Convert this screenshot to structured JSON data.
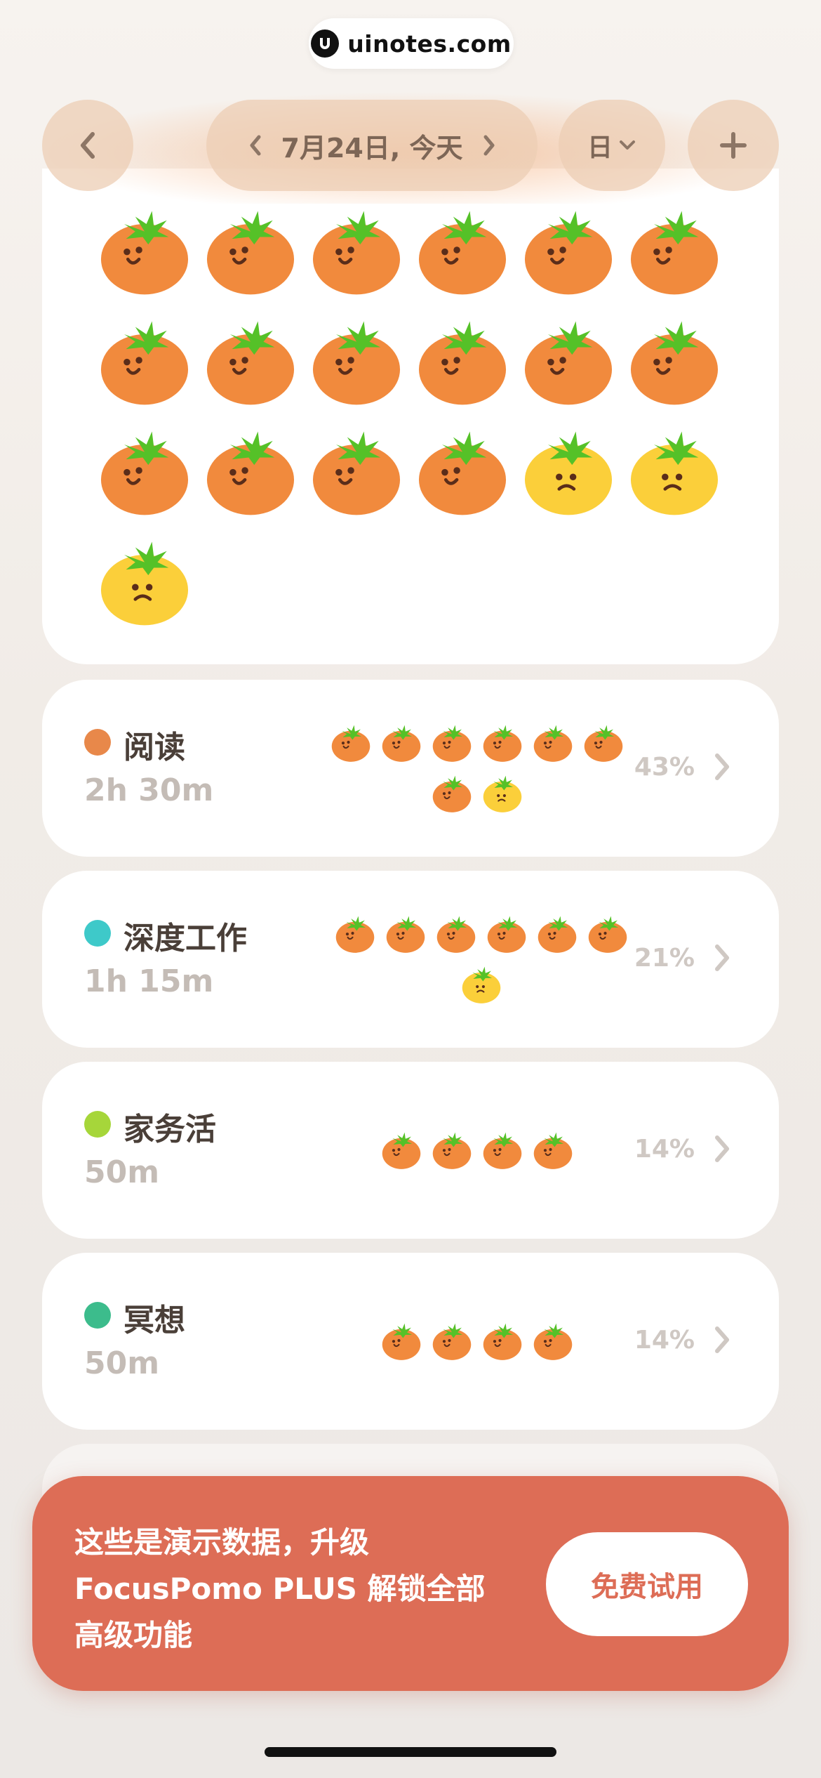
{
  "watermark": {
    "text": "uinotes.com"
  },
  "header": {
    "date_label": "7月24日, 今天",
    "mode_label": "日",
    "icons": [
      "chevron-left-icon",
      "chevron-left-icon",
      "chevron-right-icon",
      "chevron-down-icon",
      "plus-icon"
    ]
  },
  "summary": {
    "tomatoes": [
      "happy",
      "happy",
      "happy",
      "happy",
      "happy",
      "happy",
      "happy",
      "happy",
      "happy",
      "happy",
      "happy",
      "happy",
      "happy",
      "happy",
      "happy",
      "happy",
      "sad",
      "sad",
      "sad"
    ]
  },
  "categories": [
    {
      "name": "阅读",
      "time": "2h 30m",
      "percent": "43%",
      "color": "#e8884a",
      "tomatoes": [
        "happy",
        "happy",
        "happy",
        "happy",
        "happy",
        "happy",
        "happy",
        "sad"
      ]
    },
    {
      "name": "深度工作",
      "time": "1h 15m",
      "percent": "21%",
      "color": "#3ec9c9",
      "tomatoes": [
        "happy",
        "happy",
        "happy",
        "happy",
        "happy",
        "happy",
        "sad"
      ]
    },
    {
      "name": "家务活",
      "time": "50m",
      "percent": "14%",
      "color": "#a6d63a",
      "tomatoes": [
        "happy",
        "happy",
        "happy",
        "happy"
      ]
    },
    {
      "name": "冥想",
      "time": "50m",
      "percent": "14%",
      "color": "#3cbc8c",
      "tomatoes": [
        "happy",
        "happy",
        "happy",
        "happy"
      ]
    }
  ],
  "promo": {
    "line1": "这些是演示数据，升级",
    "line2": "FocusPomo PLUS 解锁全部",
    "line3": "高级功能",
    "button_label": "免费试用"
  },
  "colors": {
    "tomato_orange": "#f18a3d",
    "tomato_yellow": "#fbcf3a",
    "leaf_green": "#55c128",
    "promo_bg": "#dd6d56"
  }
}
